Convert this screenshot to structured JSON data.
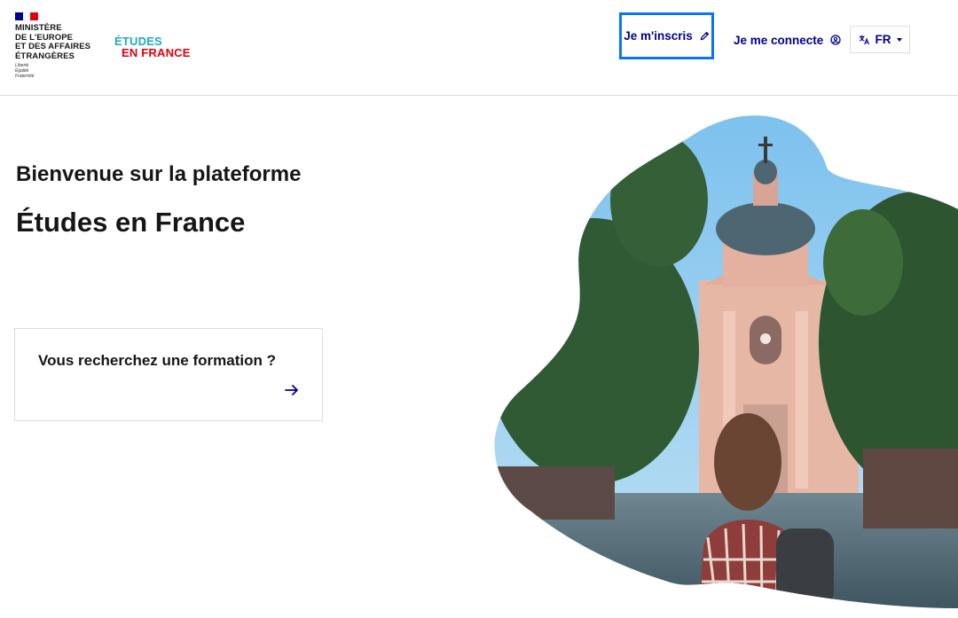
{
  "header": {
    "ministry": {
      "name": "Ministère\nde l'Europe\net des affaires\nétrangères",
      "motto": "Liberté\nÉgalité\nFraternité",
      "flag_colors": [
        "#000091",
        "#ffffff",
        "#e1000f"
      ]
    },
    "logo": {
      "line1": "ÉTUDES",
      "line2": "EN FRANCE",
      "color_primary": "#1ea9cc",
      "color_secondary": "#e1000f"
    },
    "nav": {
      "register_label": "Je m'inscris",
      "register_icon": "pencil-icon",
      "login_label": "Je me connecte",
      "login_icon": "user-circle-icon",
      "language_label": "FR",
      "language_icon": "translate-icon"
    }
  },
  "main": {
    "welcome": "Bienvenue sur la plateforme",
    "platform_name": "Études en France",
    "search_card": {
      "title": "Vous recherchez une formation ?",
      "icon": "arrow-right-icon"
    },
    "hero_image": {
      "subject": "Sorbonne chapel with student in plaid shirt and backpack"
    }
  },
  "colors": {
    "accent": "#000091",
    "focus_outline": "#0a76f6",
    "border": "#dddddd",
    "text": "#161616"
  }
}
